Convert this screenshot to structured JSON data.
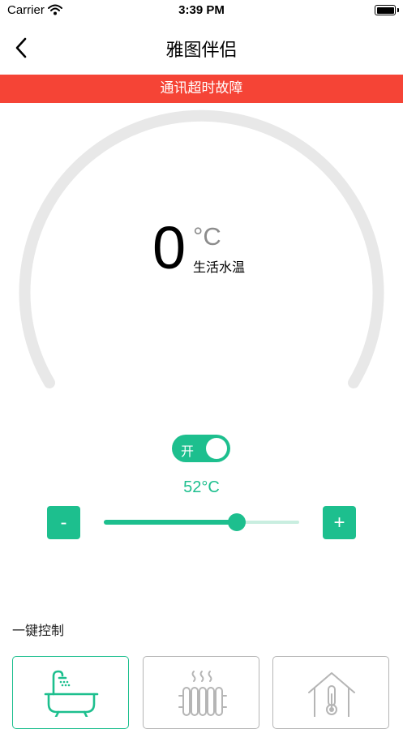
{
  "status_bar": {
    "carrier": "Carrier",
    "time": "3:39 PM"
  },
  "nav": {
    "title": "雅图伴侣",
    "back_icon": "chevron-left-icon"
  },
  "alert": {
    "text": "通讯超时故障",
    "color": "#f54436"
  },
  "gauge": {
    "value": "0",
    "unit": "°C",
    "label": "生活水温"
  },
  "power_toggle": {
    "label": "开",
    "state": "on"
  },
  "setpoint": {
    "text": "52°C",
    "value": 52,
    "slider_fraction": 0.68
  },
  "controls": {
    "minus_label": "-",
    "plus_label": "+"
  },
  "quick_control": {
    "title": "一键控制",
    "modes": [
      {
        "icon": "bathtub-shower-icon",
        "selected": true
      },
      {
        "icon": "radiator-heating-icon",
        "selected": false
      },
      {
        "icon": "house-thermometer-icon",
        "selected": false
      }
    ]
  },
  "colors": {
    "accent": "#1dbf8e",
    "alert": "#f54436",
    "gauge_track": "#e8e8e8",
    "inactive": "#b5b5b5"
  }
}
